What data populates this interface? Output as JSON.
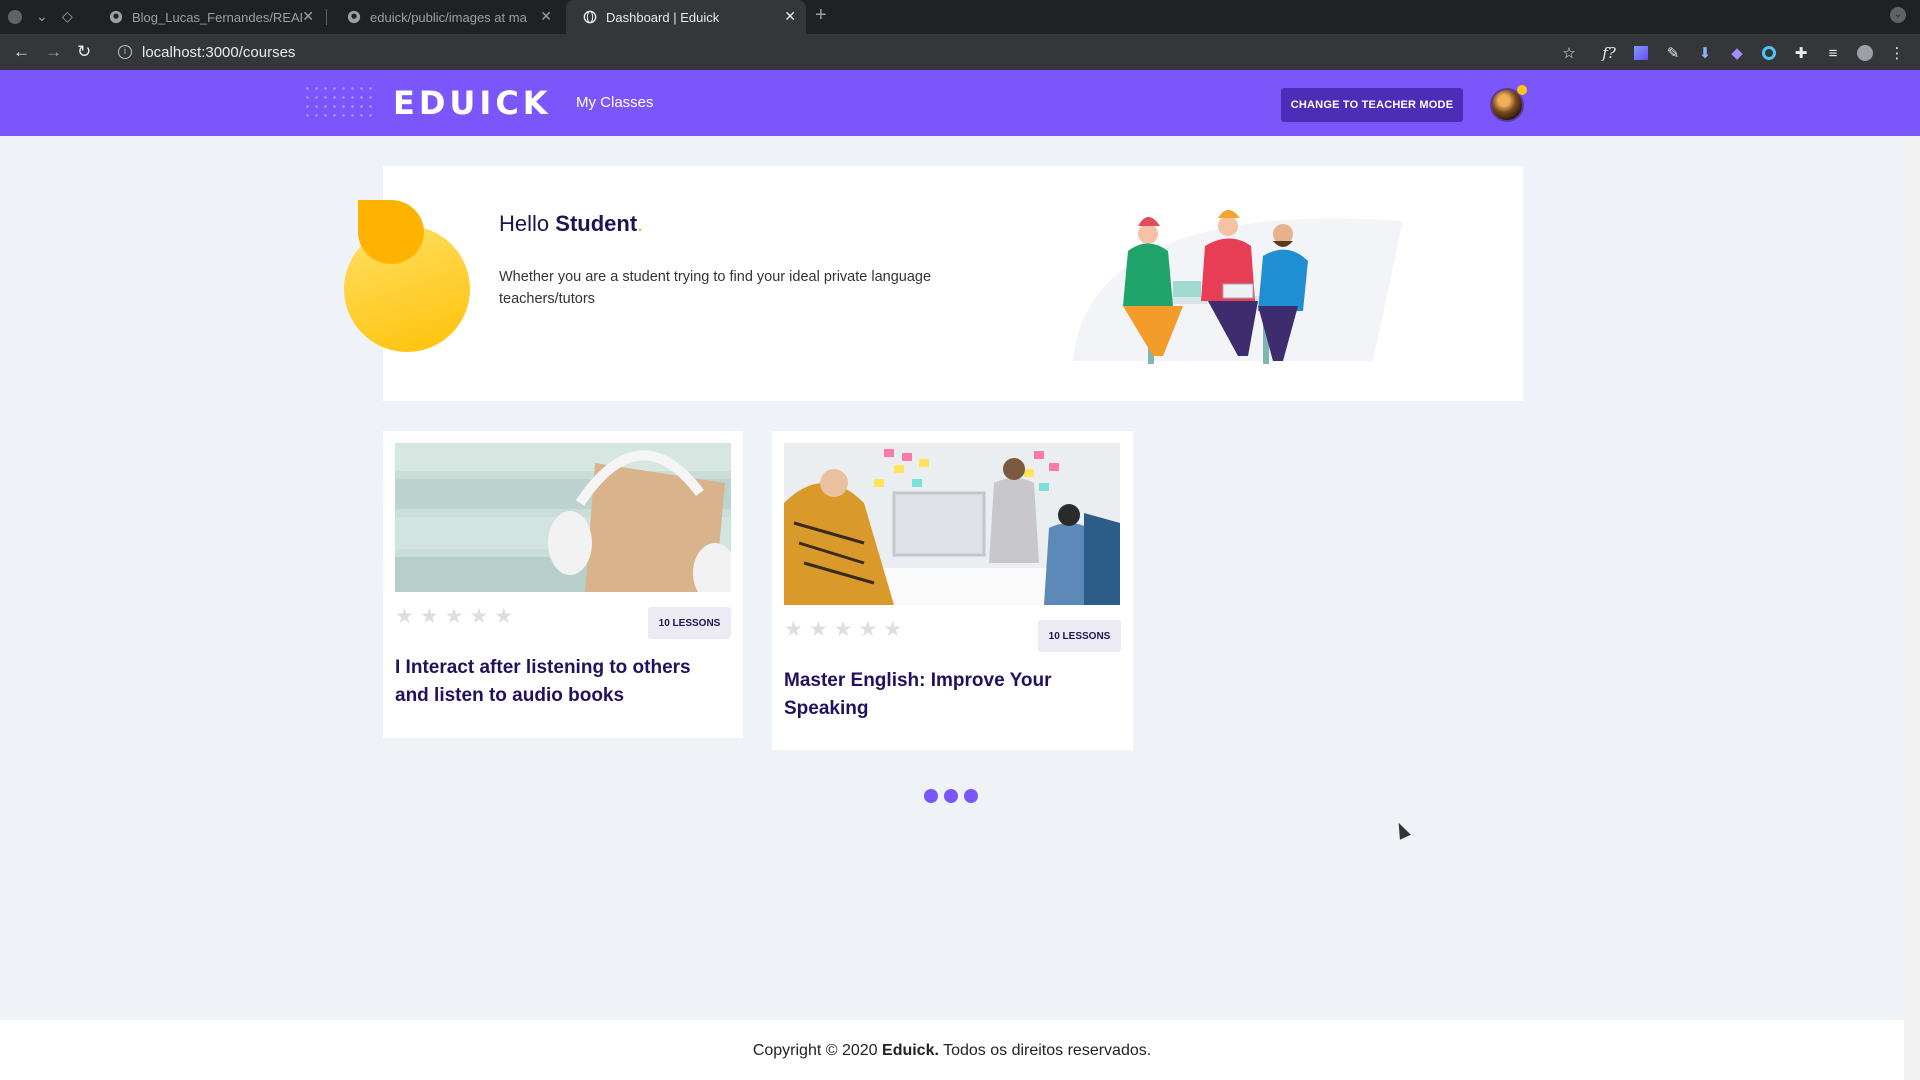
{
  "browser": {
    "tabs": [
      {
        "title": "Blog_Lucas_Fernandes/READ",
        "icon": "github-icon"
      },
      {
        "title": "eduick/public/images at ma",
        "icon": "github-icon"
      },
      {
        "title": "Dashboard | Eduick",
        "icon": "globe-icon",
        "active": true
      }
    ],
    "url": "localhost:3000/courses"
  },
  "header": {
    "logo": "EDUICK",
    "nav_my_classes": "My Classes",
    "teacher_button": "CHANGE TO TEACHER MODE",
    "accent_color": "#7b57fb"
  },
  "hero": {
    "greeting": "Hello",
    "name": "Student",
    "punct": ".",
    "description": "Whether you are a student trying to find your ideal private language teachers/tutors"
  },
  "courses": [
    {
      "title": "I Interact after listening to others and listen to audio books",
      "lessons": "10 LESSONS",
      "rating": 0
    },
    {
      "title": "Master English: Improve Your Speaking",
      "lessons": "10 LESSONS",
      "rating": 0
    }
  ],
  "footer": {
    "prefix": "Copyright © 2020",
    "brand": "Eduick.",
    "suffix": "Todos os direitos reservados."
  }
}
